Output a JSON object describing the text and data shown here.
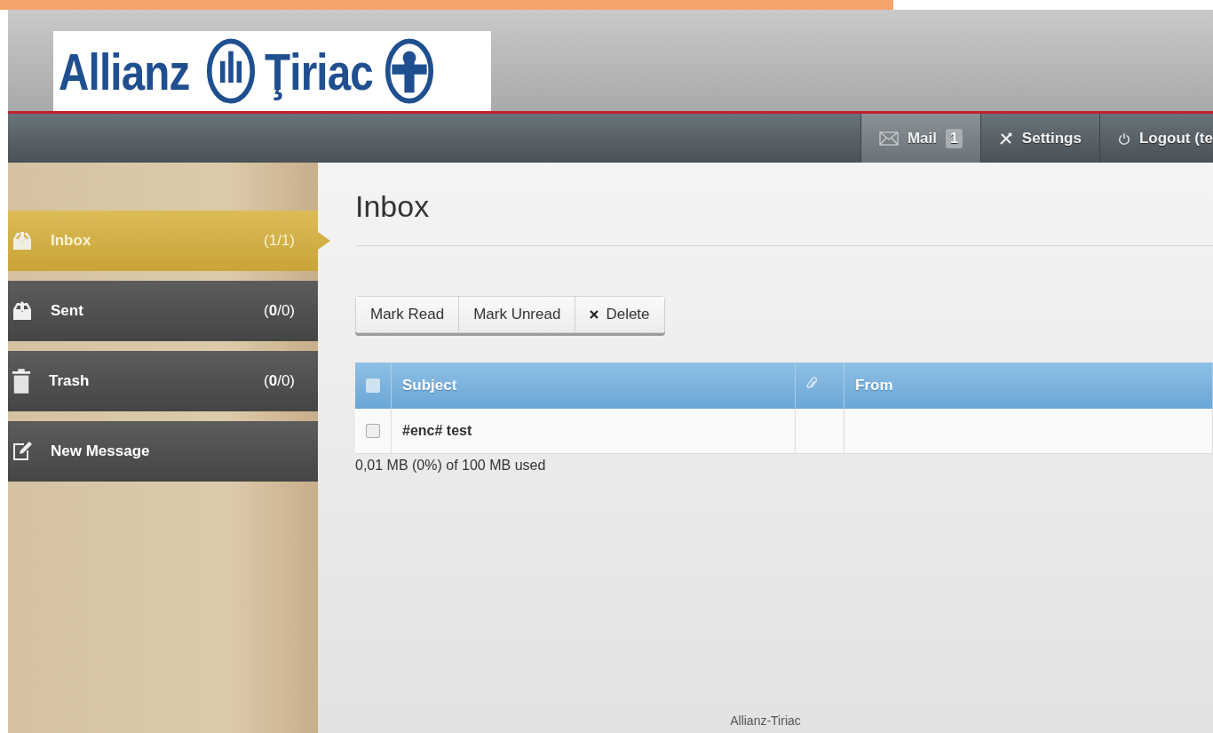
{
  "logo": {
    "word_1": "Allianz",
    "word_2": "Ţiriac"
  },
  "nav": [
    {
      "label": "Mail",
      "badge": "1",
      "selected": true
    },
    {
      "label": "Settings",
      "selected": false
    },
    {
      "label": "Logout (te",
      "selected": false
    }
  ],
  "sidebar": {
    "items": [
      {
        "label": "Inbox",
        "count": "(1/1)",
        "selected": true
      },
      {
        "label": "Sent",
        "count": "(**0**/0)",
        "selected": false
      },
      {
        "label": "Trash",
        "count": "(**0**/0)",
        "selected": false
      },
      {
        "label": "New Message",
        "selected": false
      }
    ]
  },
  "main": {
    "title": "Inbox",
    "toolbar": [
      {
        "label": "Mark Read"
      },
      {
        "label": "Mark Unread"
      },
      {
        "label": "Delete"
      }
    ],
    "table": {
      "columns": [
        {
          "label": "Subject"
        },
        {
          "label": "From"
        }
      ],
      "select_all_checked": false,
      "rows": [
        {
          "subject": "#enc# test",
          "checked": false
        }
      ]
    },
    "quota": "0,01 MB (0%) of 100 MB used"
  },
  "footer": "Allianz-Tiriac"
}
